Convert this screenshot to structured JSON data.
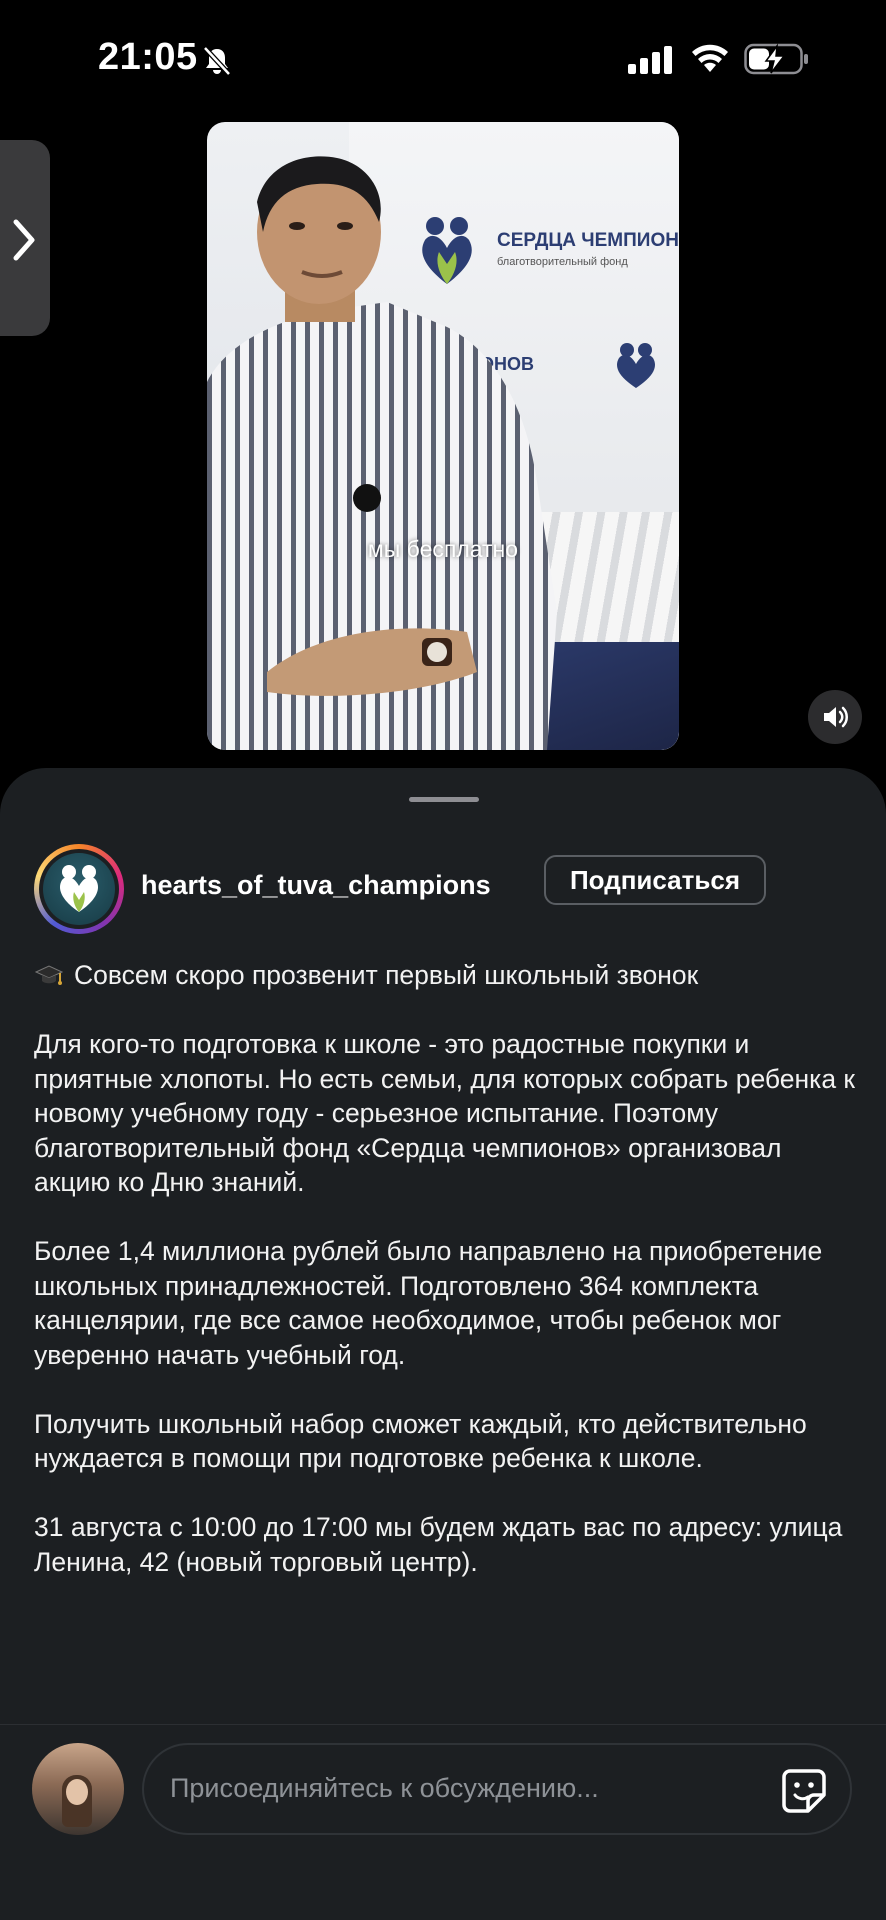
{
  "status_bar": {
    "time": "21:05"
  },
  "video": {
    "subtitle": "мы бесплатно",
    "fund_name_visible": "СЕРДЦА ЧЕМПИОНОВ",
    "fund_sub_visible": "благотворительный фонд",
    "fund_frag_visible": "ИОНОВ",
    "fund_frag_left": "В"
  },
  "post": {
    "username": "hearts_of_tuva_champions",
    "follow_label": "Подписаться",
    "caption": [
      "Совсем скоро прозвенит первый школьный звонок",
      "Для кого-то подготовка к школе - это радостные покупки и приятные хлопоты. Но есть семьи, для которых собрать ребенка к новому учебному году - серьезное испытание. Поэтому благотворительный фонд «Сердца чемпионов» организовал акцию ко Дню знаний.",
      "Более 1,4 миллиона рублей было направлено на приобретение школьных принадлежностей. Подготовлено 364 комплекта канцелярии, где все самое необходимое, чтобы ребенок мог уверенно начать учебный год.",
      "Получить школьный набор сможет каждый, кто действительно нуждается в помощи при подготовке ребенка к школе.",
      "31 августа с 10:00 до 17:00 мы будем ждать вас по адресу: улица Ленина, 42 (новый торговый центр)."
    ],
    "caption_icon": "graduation-cap-icon"
  },
  "comment": {
    "placeholder": "Присоединяйтесь к обсуждению..."
  },
  "icons": {
    "bell": "bell-off-icon",
    "sound": "speaker-icon",
    "sticker": "sticker-icon",
    "side_tab": "chevron-right-icon"
  },
  "colors": {
    "sheet_bg": "#1c1f22",
    "accent_fund": "#2c3e73"
  }
}
